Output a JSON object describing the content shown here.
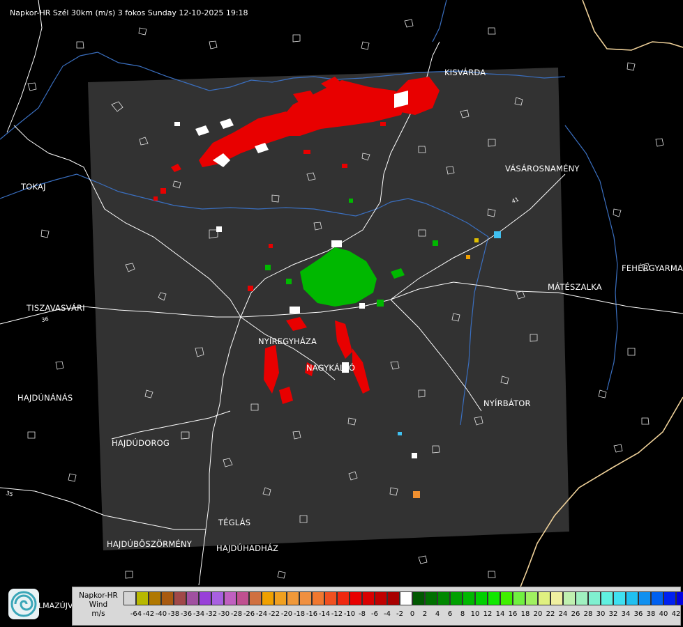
{
  "title": "Napkor-HR Szél 30km (m/s) 3 fokos Sunday 12-10-2025 19:18",
  "cities": [
    {
      "name": "KISVÁRDA"
    },
    {
      "name": "TOKAJ"
    },
    {
      "name": "VÁSÁROSNAMÉNY"
    },
    {
      "name": "FEHÉRGYARMA"
    },
    {
      "name": "MÁTÉSZALKA"
    },
    {
      "name": "TISZAVASVÁRI"
    },
    {
      "name": "NYÍREGYHÁZA"
    },
    {
      "name": "NAGYKÁLLÓ"
    },
    {
      "name": "HAJDÚNÁNÁS"
    },
    {
      "name": "NYÍRBÁTOR"
    },
    {
      "name": "HAJDÚDOROG"
    },
    {
      "name": "TÉGLÁS"
    },
    {
      "name": "HAJDÚBÖSZÖRMÉNY"
    },
    {
      "name": "HAJDÚHADHÁZ"
    }
  ],
  "road_numbers": [
    "36",
    "41",
    "35"
  ],
  "legend": {
    "product": "Napkor-HR",
    "quantity": "Wind",
    "unit": "m/s",
    "ticks": [
      "-64",
      "-42",
      "-40",
      "-38",
      "-36",
      "-34",
      "-32",
      "-30",
      "-28",
      "-26",
      "-24",
      "-22",
      "-20",
      "-18",
      "-16",
      "-14",
      "-12",
      "-10",
      "-8",
      "-6",
      "-4",
      "-2",
      "0",
      "2",
      "4",
      "6",
      "8",
      "10",
      "12",
      "14",
      "16",
      "18",
      "20",
      "22",
      "24",
      "26",
      "28",
      "30",
      "32",
      "34",
      "36",
      "38",
      "40",
      "42"
    ],
    "colors": [
      "#d4d4d4",
      "#b8b800",
      "#b07800",
      "#a85a10",
      "#a04848",
      "#a050a0",
      "#9840d8",
      "#a860e0",
      "#c060c0",
      "#c05090",
      "#d07040",
      "#f0a000",
      "#f0a020",
      "#f09838",
      "#f09040",
      "#f07830",
      "#f05020",
      "#f02810",
      "#e80000",
      "#d80000",
      "#c00000",
      "#a80000",
      "#ffffff",
      "#005800",
      "#007000",
      "#008800",
      "#00a000",
      "#00b800",
      "#00d000",
      "#10e800",
      "#40f000",
      "#70f040",
      "#a0f060",
      "#e0f080",
      "#f0f0a0",
      "#c0f0b0",
      "#a0f0c0",
      "#80f0d0",
      "#60f0e0",
      "#40e0f0",
      "#20c0f0",
      "#1090f0",
      "#0060f0",
      "#0020f0",
      "#0000e0"
    ]
  },
  "logo_text": "LMAZÚJVÁR",
  "colors": {
    "radar_domain": "#323232",
    "background": "#000000",
    "outline": "#ffffff",
    "river": "#3a6fc0",
    "border": "#f0d29a",
    "approaching": "#e80000",
    "receding": "#00b800"
  }
}
